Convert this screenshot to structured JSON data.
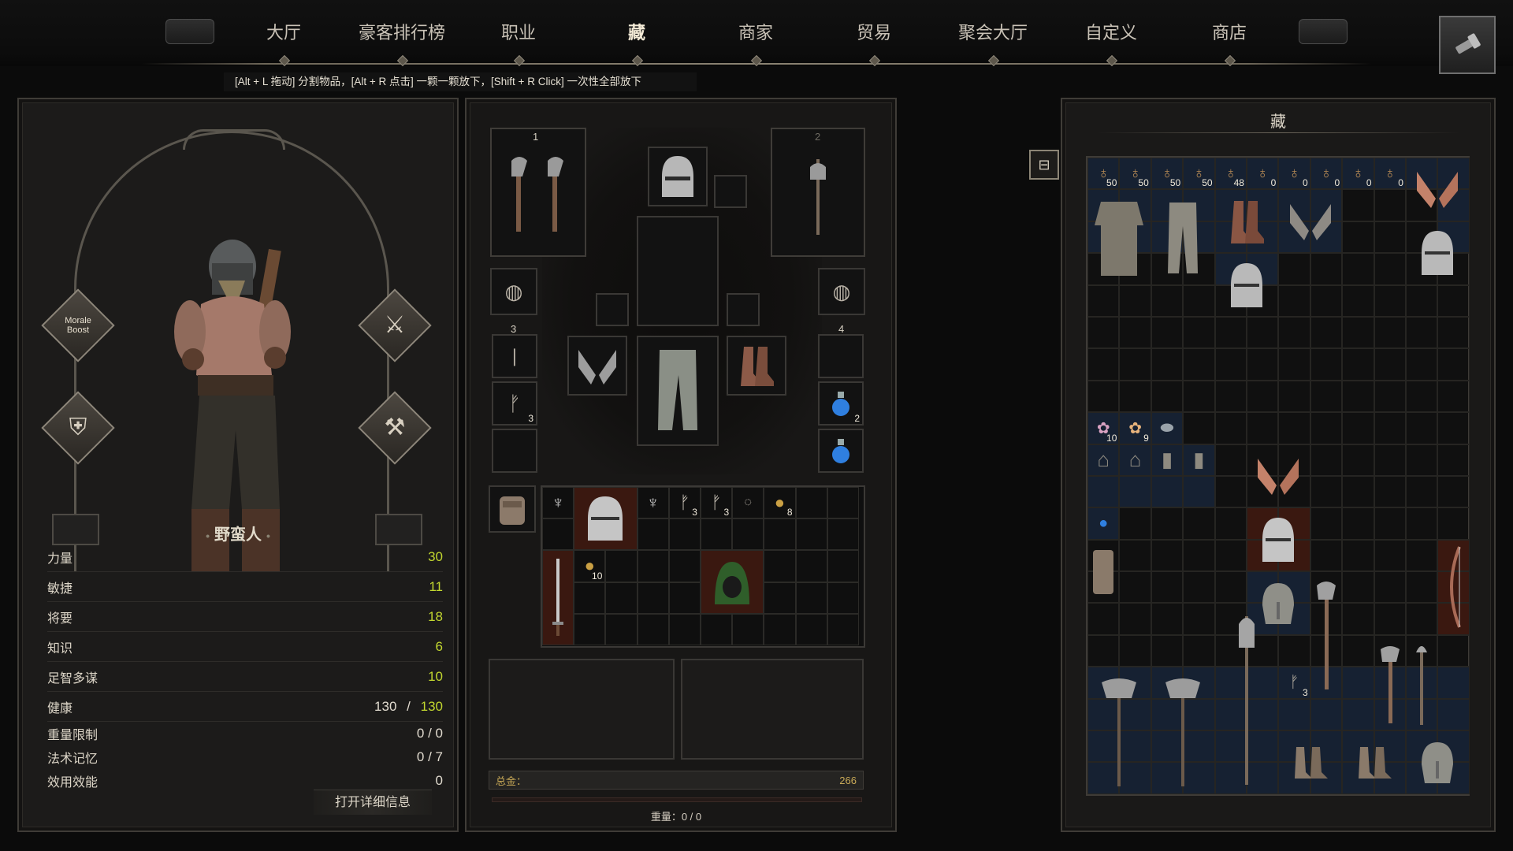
{
  "nav": {
    "tabs": [
      {
        "label": "大厅",
        "active": false
      },
      {
        "label": "豪客排行榜",
        "active": false
      },
      {
        "label": "职业",
        "active": false
      },
      {
        "label": "藏",
        "active": true
      },
      {
        "label": "商家",
        "active": false
      },
      {
        "label": "贸易",
        "active": false
      },
      {
        "label": "聚会大厅",
        "active": false
      },
      {
        "label": "自定义",
        "active": false
      },
      {
        "label": "商店",
        "active": false
      }
    ],
    "hint": "[Alt + L 拖动] 分割物品，[Alt + R 点击] 一颗一颗放下，[Shift + R Click] 一次性全部放下",
    "settings_icon": "flashlight-icon"
  },
  "character": {
    "class_name": "野蛮人",
    "perk_morale": "Morale Boost",
    "stats": [
      {
        "label": "力量",
        "value": "30"
      },
      {
        "label": "敏捷",
        "value": "11"
      },
      {
        "label": "将要",
        "value": "18"
      },
      {
        "label": "知识",
        "value": "6"
      },
      {
        "label": "足智多谋",
        "value": "10"
      }
    ],
    "health": {
      "label": "健康",
      "current": "130",
      "sep": "/",
      "max": "130"
    },
    "weight_limit": {
      "label": "重量限制",
      "value": "0 / 0"
    },
    "spell_memory": {
      "label": "法术记忆",
      "value": "0 / 7"
    },
    "effect_power": {
      "label": "效用效能",
      "value": "0"
    },
    "detail_button": "打开详细信息"
  },
  "equipment": {
    "slot1_label": "1",
    "slot2_label": "2",
    "slot3_label": "3",
    "slot4_label": "4",
    "utility_throw_qty": "3",
    "potion_qty": "2",
    "bag_items": {
      "throw_axe_a_qty": "3",
      "throw_axe_b_qty": "3",
      "gold_coins_qty": "8",
      "gold_pile_qty": "10"
    },
    "gold_label": "总金：",
    "gold_value": "266",
    "weight_label": "重量：0 / 0"
  },
  "stash": {
    "title": "藏",
    "coin_bags": [
      "50",
      "50",
      "50",
      "50",
      "48",
      "0",
      "0",
      "0",
      "0",
      "0"
    ],
    "gem_a_qty": "10",
    "gem_b_qty": "9",
    "throw_axe_qty": "3"
  },
  "colors": {
    "stat_value": "#c2d72f",
    "gold_text": "#c8a957",
    "rarity_uncommon_bg": "#162132",
    "rarity_epic_bg": "#3a1810"
  }
}
